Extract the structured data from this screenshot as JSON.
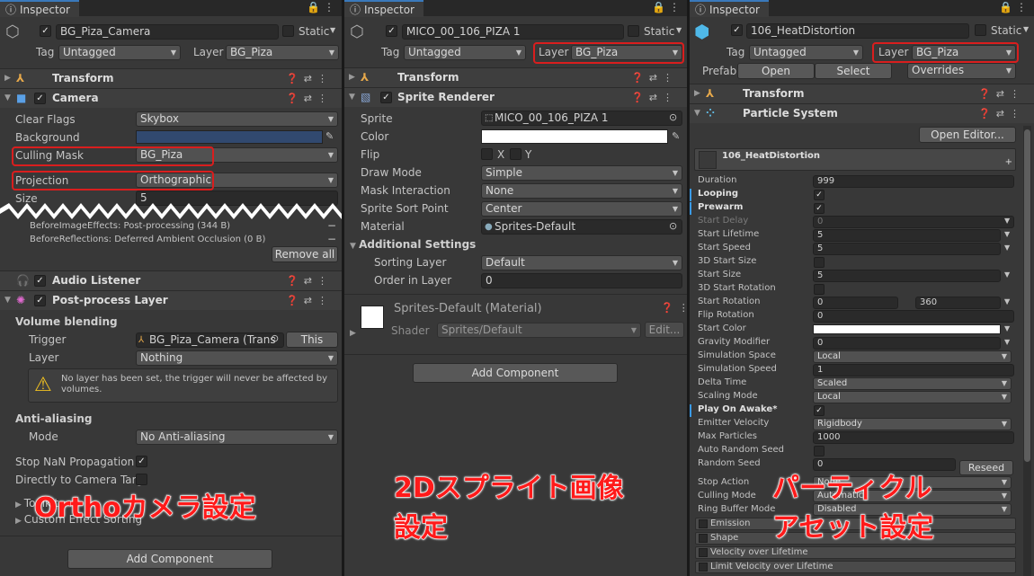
{
  "inspector_tab": "Inspector",
  "camera_panel": {
    "object_name": "BG_Piza_Camera",
    "static_label": "Static",
    "tag_label": "Tag",
    "tag_value": "Untagged",
    "layer_label": "Layer",
    "layer_value": "BG_Piza",
    "transform": "Transform",
    "camera": "Camera",
    "clear_flags_label": "Clear Flags",
    "clear_flags_value": "Skybox",
    "background_label": "Background",
    "culling_mask_label": "Culling Mask",
    "culling_mask_value": "BG_Piza",
    "projection_label": "Projection",
    "projection_value": "Orthographic",
    "size_label": "Size",
    "size_value": "5",
    "before_image_effects": "BeforeImageEffects: Post-processing (344 B)",
    "before_reflections": "BeforeReflections: Deferred Ambient Occlusion (0 B)",
    "remove_all": "Remove all",
    "audio_listener": "Audio Listener",
    "post_process_layer": "Post-process Layer",
    "volume_blending": "Volume blending",
    "trigger_label": "Trigger",
    "trigger_value": "BG_Piza_Camera (Trans",
    "this_button": "This",
    "layer2_label": "Layer",
    "layer2_value": "Nothing",
    "warning_text": "No layer has been set, the trigger will never be affected by volumes.",
    "anti_aliasing": "Anti-aliasing",
    "mode_label": "Mode",
    "mode_value": "No Anti-aliasing",
    "stop_nan_label": "Stop NaN Propagation",
    "directly_label": "Directly to Camera Targ",
    "toolkit_label": "Toolkit",
    "custom_effect_label": "Custom Effect Sorting",
    "add_component": "Add Component",
    "overlay_text": "Orthoカメラ設定"
  },
  "sprite_panel": {
    "object_name": "MICO_00_106_PIZA 1",
    "static_label": "Static",
    "tag_label": "Tag",
    "tag_value": "Untagged",
    "layer_label": "Layer",
    "layer_value": "BG_Piza",
    "transform": "Transform",
    "sprite_renderer": "Sprite Renderer",
    "sprite_label": "Sprite",
    "sprite_value": "MICO_00_106_PIZA 1",
    "color_label": "Color",
    "flip_label": "Flip",
    "flip_x": "X",
    "flip_y": "Y",
    "draw_mode_label": "Draw Mode",
    "draw_mode_value": "Simple",
    "mask_label": "Mask Interaction",
    "mask_value": "None",
    "sort_point_label": "Sprite Sort Point",
    "sort_point_value": "Center",
    "material_label": "Material",
    "material_value": "Sprites-Default",
    "additional_settings": "Additional Settings",
    "sorting_layer_label": "Sorting Layer",
    "sorting_layer_value": "Default",
    "order_label": "Order in Layer",
    "order_value": "0",
    "material_header": "Sprites-Default (Material)",
    "shader_label": "Shader",
    "shader_value": "Sprites/Default",
    "edit_button": "Edit...",
    "add_component": "Add Component",
    "overlay_line1": "2Dスプライト画像",
    "overlay_line2": "設定"
  },
  "particle_panel": {
    "object_name": "106_HeatDistortion",
    "static_label": "Static",
    "tag_label": "Tag",
    "tag_value": "Untagged",
    "layer_label": "Layer",
    "layer_value": "BG_Piza",
    "prefab_label": "Prefab",
    "open_button": "Open",
    "select_button": "Select",
    "overrides_value": "Overrides",
    "transform": "Transform",
    "particle_system": "Particle System",
    "open_editor": "Open Editor...",
    "system_name": "106_HeatDistortion",
    "rows": [
      {
        "label": "Duration",
        "value": "999"
      },
      {
        "label": "Looping",
        "value": "✓"
      },
      {
        "label": "Prewarm",
        "value": "✓"
      },
      {
        "label": "Start Delay",
        "value": "0"
      },
      {
        "label": "Start Lifetime",
        "value": "5"
      },
      {
        "label": "Start Speed",
        "value": "5"
      },
      {
        "label": "3D Start Size",
        "value": ""
      },
      {
        "label": "Start Size",
        "value": "5"
      },
      {
        "label": "3D Start Rotation",
        "value": ""
      },
      {
        "label": "Start Rotation",
        "value": "0"
      },
      {
        "label": "Flip Rotation",
        "value": "0"
      },
      {
        "label": "Start Color",
        "value": ""
      },
      {
        "label": "Gravity Modifier",
        "value": "0"
      },
      {
        "label": "Simulation Space",
        "value": "Local"
      },
      {
        "label": "Simulation Speed",
        "value": "1"
      },
      {
        "label": "Delta Time",
        "value": "Scaled"
      },
      {
        "label": "Scaling Mode",
        "value": "Local"
      },
      {
        "label": "Play On Awake*",
        "value": "✓"
      },
      {
        "label": "Emitter Velocity",
        "value": "Rigidbody"
      },
      {
        "label": "Max Particles",
        "value": "1000"
      },
      {
        "label": "Auto Random Seed",
        "value": ""
      },
      {
        "label": "Random Seed",
        "value": "0"
      }
    ],
    "start_rotation_max": "360",
    "reseed_button": "Reseed",
    "stop_action_label": "Stop Action",
    "stop_action_value": "None",
    "culling_mode_label": "Culling Mode",
    "culling_mode_value": "Automatic",
    "ring_buffer_label": "Ring Buffer Mode",
    "ring_buffer_value": "Disabled",
    "modules": [
      "Emission",
      "Shape",
      "Velocity over Lifetime",
      "Limit Velocity over Lifetime"
    ],
    "overlay_line1": "パーティクル",
    "overlay_line2": "アセット設定"
  },
  "colors": {
    "overlay_red": "#ff1a1a",
    "highlight_red": "#d91e1e",
    "panel_bg": "#383838",
    "background_swatch": "#31496f"
  }
}
